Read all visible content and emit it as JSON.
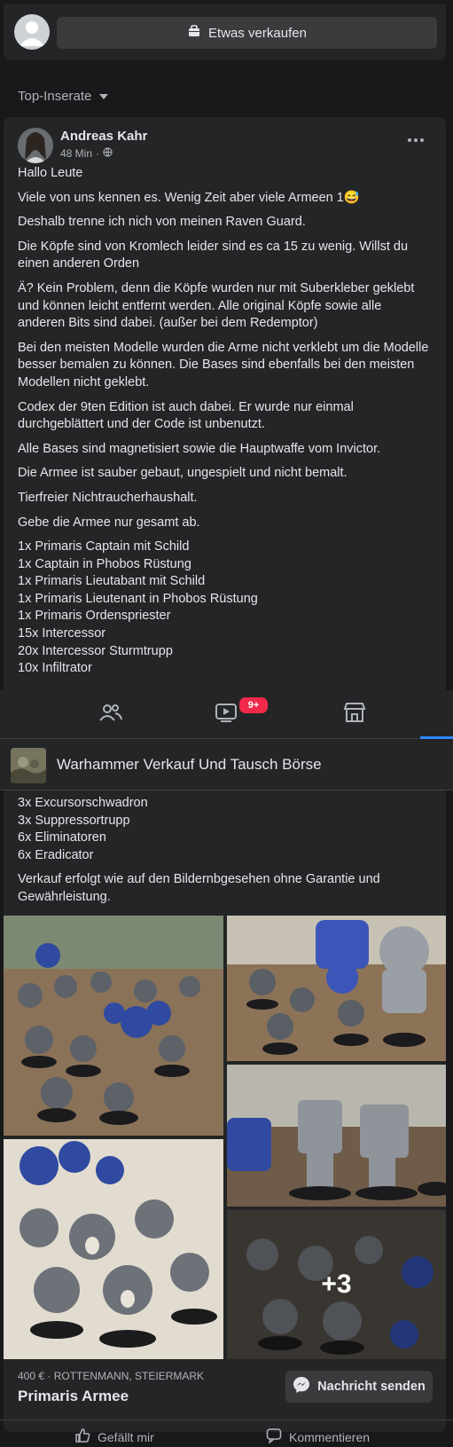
{
  "composer": {
    "sell_label": "Etwas verkaufen"
  },
  "feed": {
    "filter_label": "Top-Inserate"
  },
  "post": {
    "author": "Andreas Kahr",
    "time": "48 Min",
    "paragraphs": [
      "Hallo Leute",
      "Viele von uns kennen es. Wenig Zeit aber viele Armeen 1😅",
      "Deshalb trenne ich nich von meinen Raven Guard.",
      "Die Köpfe sind von Kromlech leider sind es ca 15 zu wenig. Willst du einen anderen Orden",
      "Ä? Kein Problem, denn die Köpfe wurden nur mit Suberkleber geklebt und können leicht entfernt werden. Alle original Köpfe sowie alle anderen Bits sind dabei. (außer bei dem Redemptor)",
      "Bei den meisten Modelle wurden die Arme nicht verklebt um die Modelle besser bemalen zu können. Die Bases sind ebenfalls bei den meisten Modellen nicht geklebt.",
      "Codex der 9ten Edition ist auch dabei. Er wurde nur einmal durchgeblättert und der Code ist unbenutzt.",
      "Alle Bases sind magnetisiert sowie die Hauptwaffe vom Invictor.",
      "Die Armee ist sauber gebaut, ungespielt und nicht bemalt.",
      "Tierfreier Nichtraucherhaushalt.",
      "Gebe die Armee nur gesamt ab."
    ],
    "list": [
      "1x Primaris Captain mit Schild",
      "1x Captain in Phobos Rüstung",
      "1x Primaris Lieutabant mit Schild",
      "1x Primaris Lieutenant in Phobos Rüstung",
      "1x Primaris Ordenspriester",
      "15x Intercessor",
      "20x Intercessor Sturmtrupp",
      "10x Infiltrator"
    ],
    "list_continued": [
      "3x Excursorschwadron",
      "3x Suppressortrupp",
      "6x Eliminatoren",
      "6x Eradicator"
    ],
    "closing": "Verkauf erfolgt wie auf den Bildernbgesehen ohne Garantie und Gewährleistung.",
    "more_photos": "+3"
  },
  "nav": {
    "badge": "9+"
  },
  "group": {
    "title": "Warhammer Verkauf Und Tausch Börse"
  },
  "listing": {
    "price_location": "400 € · ROTTENMANN, STEIERMARK",
    "title": "Primaris Armee",
    "message_button": "Nachricht senden"
  },
  "actions": {
    "like": "Gefällt mir",
    "comment": "Kommentieren"
  },
  "colors": {
    "background": "#18191a",
    "card": "#242526",
    "accent": "#2d88ff",
    "badge": "#f02849"
  }
}
